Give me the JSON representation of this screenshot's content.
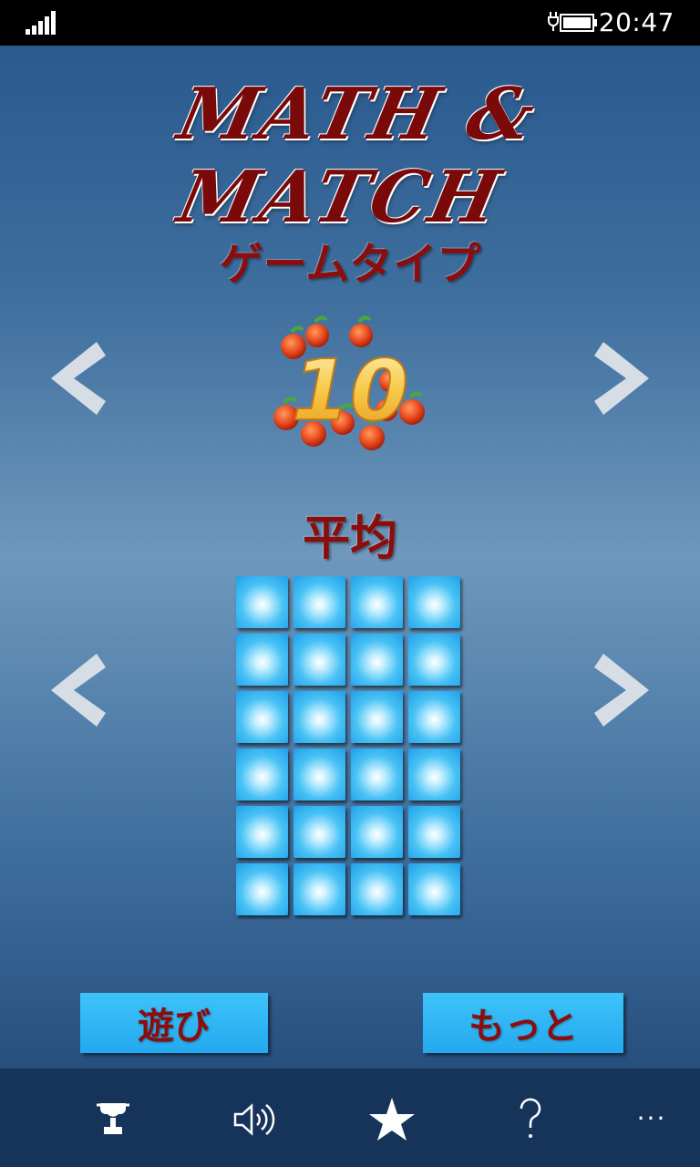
{
  "status_bar": {
    "time": "20:47",
    "signal_icon": "signal-bars-icon",
    "battery_icon": "battery-charging-icon"
  },
  "app": {
    "logo_text": "MATH & MATCH",
    "game_type_title": "ゲームタイプ",
    "game_type_image_number": "10",
    "difficulty_title": "平均",
    "grid": {
      "rows": 6,
      "columns": 4
    },
    "play_button_label": "遊び",
    "more_button_label": "もっと",
    "colors": {
      "title_red": "#8b0d0d",
      "tile_blue": "#48c2f5",
      "button_blue": "#2bb3f3",
      "app_bar": "#16345a"
    }
  },
  "app_bar": {
    "items": [
      "trophy-icon",
      "speaker-icon",
      "star-icon",
      "question-icon"
    ],
    "more_label": "..."
  }
}
